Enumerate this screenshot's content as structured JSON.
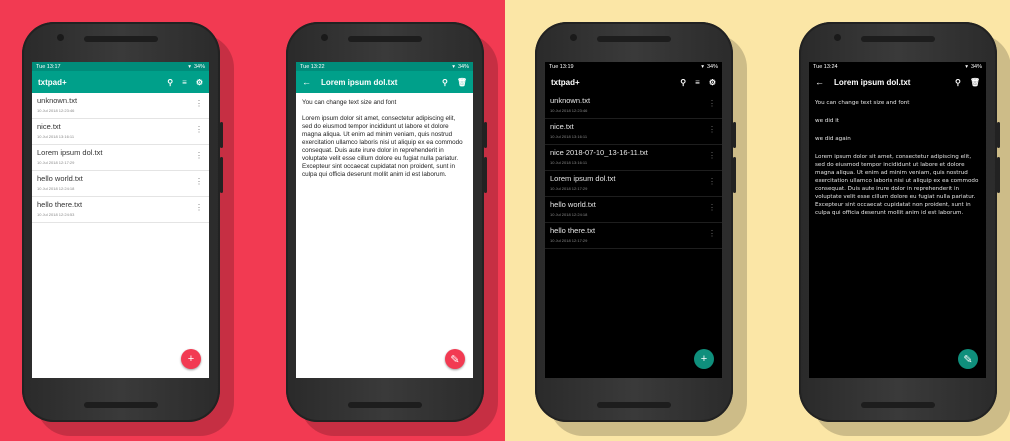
{
  "colors": {
    "left_bg": "#f23a52",
    "right_bg": "#fbe6a6",
    "teal": "#00a08a",
    "accent_red": "#f23a52"
  },
  "phones": [
    {
      "status": {
        "time": "Tue 13:17",
        "battery": "34%"
      },
      "appbar": {
        "title": "txtpad+"
      },
      "files": [
        {
          "name": "unknown.txt",
          "date": "10 Jul 2018 12:23:46"
        },
        {
          "name": "nice.txt",
          "date": "10 Jul 2018 13:16:11"
        },
        {
          "name": "Lorem ipsum dol.txt",
          "date": "10 Jul 2018 12:17:29"
        },
        {
          "name": "hello world.txt",
          "date": "10 Jul 2018 12:24:18"
        },
        {
          "name": "hello there.txt",
          "date": "10 Jul 2018 12:24:53"
        }
      ],
      "fab": "+"
    },
    {
      "status": {
        "time": "Tue 13:22",
        "battery": "34%"
      },
      "appbar": {
        "title": "Lorem ipsum dol.txt"
      },
      "doc": {
        "p1": "You can change text size and font",
        "p2": "Lorem ipsum dolor sit amet, consectetur adipiscing elit, sed do eiusmod tempor incididunt ut labore et dolore magna aliqua. Ut enim ad minim veniam, quis nostrud exercitation ullamco laboris nisi ut aliquip ex ea commodo consequat. Duis aute irure dolor in reprehenderit in voluptate velit esse cillum dolore eu fugiat nulla pariatur. Excepteur sint occaecat cupidatat non proident, sunt in culpa qui officia deserunt mollit anim id est laborum."
      },
      "fab": "✎"
    },
    {
      "status": {
        "time": "Tue 13:19",
        "battery": "34%"
      },
      "appbar": {
        "title": "txtpad+"
      },
      "files": [
        {
          "name": "unknown.txt",
          "date": "10 Jul 2018 12:23:46"
        },
        {
          "name": "nice.txt",
          "date": "10 Jul 2018 13:16:11"
        },
        {
          "name": "nice 2018-07-10_13-16-11.txt",
          "date": "10 Jul 2018 13:16:11"
        },
        {
          "name": "Lorem ipsum dol.txt",
          "date": "10 Jul 2018 12:17:29"
        },
        {
          "name": "hello world.txt",
          "date": "10 Jul 2018 12:24:18"
        },
        {
          "name": "hello there.txt",
          "date": "10 Jul 2018 12:17:29"
        }
      ],
      "fab": "+"
    },
    {
      "status": {
        "time": "Tue 13:24",
        "battery": "34%"
      },
      "appbar": {
        "title": "Lorem ipsum dol.txt"
      },
      "doc": {
        "p1": "You can change text size and font",
        "p2": "we did it",
        "p3": "we did again",
        "p4": "Lorem ipsum dolor sit amet, consectetur adipiscing elit, sed do eiusmod tempor incididunt ut labore et dolore magna aliqua. Ut enim ad minim veniam, quis nostrud exercitation ullamco laboris nisi ut aliquip ex ea commodo consequat. Duis aute irure dolor in reprehenderit in voluptate velit esse cillum dolore eu fugiat nulla pariatur. Excepteur sint occaecat cupidatat non proident, sunt in culpa qui officia deserunt mollit anim id est laborum."
      },
      "fab": "✎"
    }
  ],
  "icons": {
    "back": "←",
    "search": "⚲",
    "sort": "≡",
    "settings": "⚙",
    "delete": "🗑",
    "menu": "⋮"
  }
}
